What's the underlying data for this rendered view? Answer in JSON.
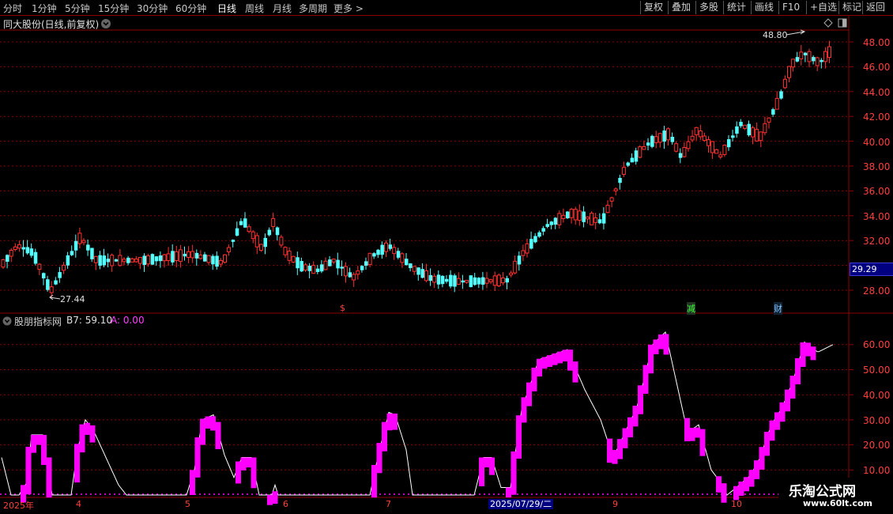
{
  "toolbar": {
    "periods": [
      "分时",
      "1分钟",
      "5分钟",
      "15分钟",
      "30分钟",
      "60分钟",
      "日线",
      "周线",
      "月线",
      "多周期",
      "更多 >"
    ],
    "active_period": "日线",
    "right_buttons": [
      "复权",
      "叠加",
      "多股",
      "统计",
      "画线",
      "F10",
      "+自选",
      "返回"
    ],
    "mark_button": "标记"
  },
  "main_chart": {
    "title": "同大股份(日线,前复权)",
    "y_ticks": [
      "48.00",
      "46.00",
      "44.00",
      "42.00",
      "40.00",
      "38.00",
      "36.00",
      "34.00",
      "32.00",
      "28.00"
    ],
    "current_price": "29.29",
    "high_label": "48.80",
    "low_label": "27.44",
    "markers": {
      "dollar": "$",
      "reduce": "减",
      "finance": "财"
    }
  },
  "indicator": {
    "name": "股朋指标网",
    "b7_label": "B7: 59.10",
    "a_label": "A: 0.00",
    "y_ticks": [
      "60.00",
      "50.00",
      "40.00",
      "30.00",
      "20.00",
      "10.00"
    ]
  },
  "x_axis": {
    "labels": [
      "2025年",
      "4",
      "5",
      "6",
      "7",
      "9",
      "10"
    ],
    "cursor_date": "2025/07/29/二"
  },
  "watermark": {
    "line1": "乐淘公式网",
    "line2": "www.60lt.com"
  },
  "colors": {
    "up": "#ff3232",
    "down": "#54ffff",
    "magenta": "#ff00ff",
    "grid": "#8b0000"
  }
}
